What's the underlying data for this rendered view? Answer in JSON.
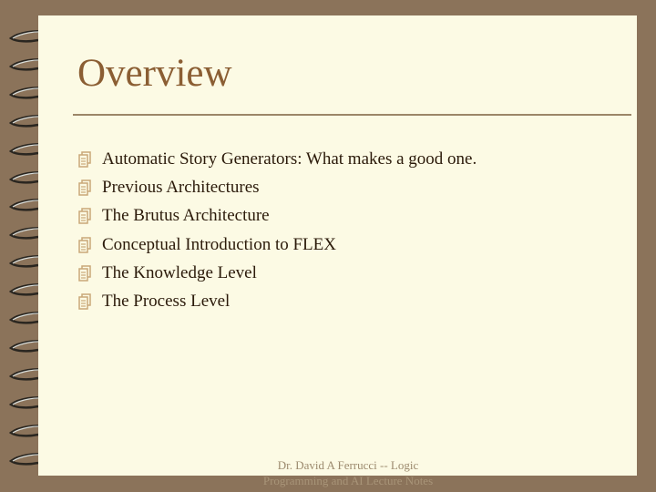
{
  "slide": {
    "title": "Overview",
    "bullets": [
      {
        "icon": "document-stack-icon",
        "text": "Automatic Story Generators: What makes a good one."
      },
      {
        "icon": "document-stack-icon",
        "text": "Previous Architectures"
      },
      {
        "icon": "document-stack-icon",
        "text": "The Brutus Architecture"
      },
      {
        "icon": "document-stack-icon",
        "text": "Conceptual Introduction to FLEX"
      },
      {
        "icon": "document-stack-icon",
        "text": "The Knowledge Level"
      },
      {
        "icon": "document-stack-icon",
        "text": "The Process Level"
      }
    ],
    "footer": {
      "line1": "Dr. David A Ferrucci   -- Logic",
      "line2": "Programming and AI Lecture Notes"
    }
  },
  "theme": {
    "background": "#8b735a",
    "page": "#fcfae4",
    "title_color": "#8b5e33",
    "text_color": "#2b1a0a",
    "icon_color": "#c9a878"
  }
}
